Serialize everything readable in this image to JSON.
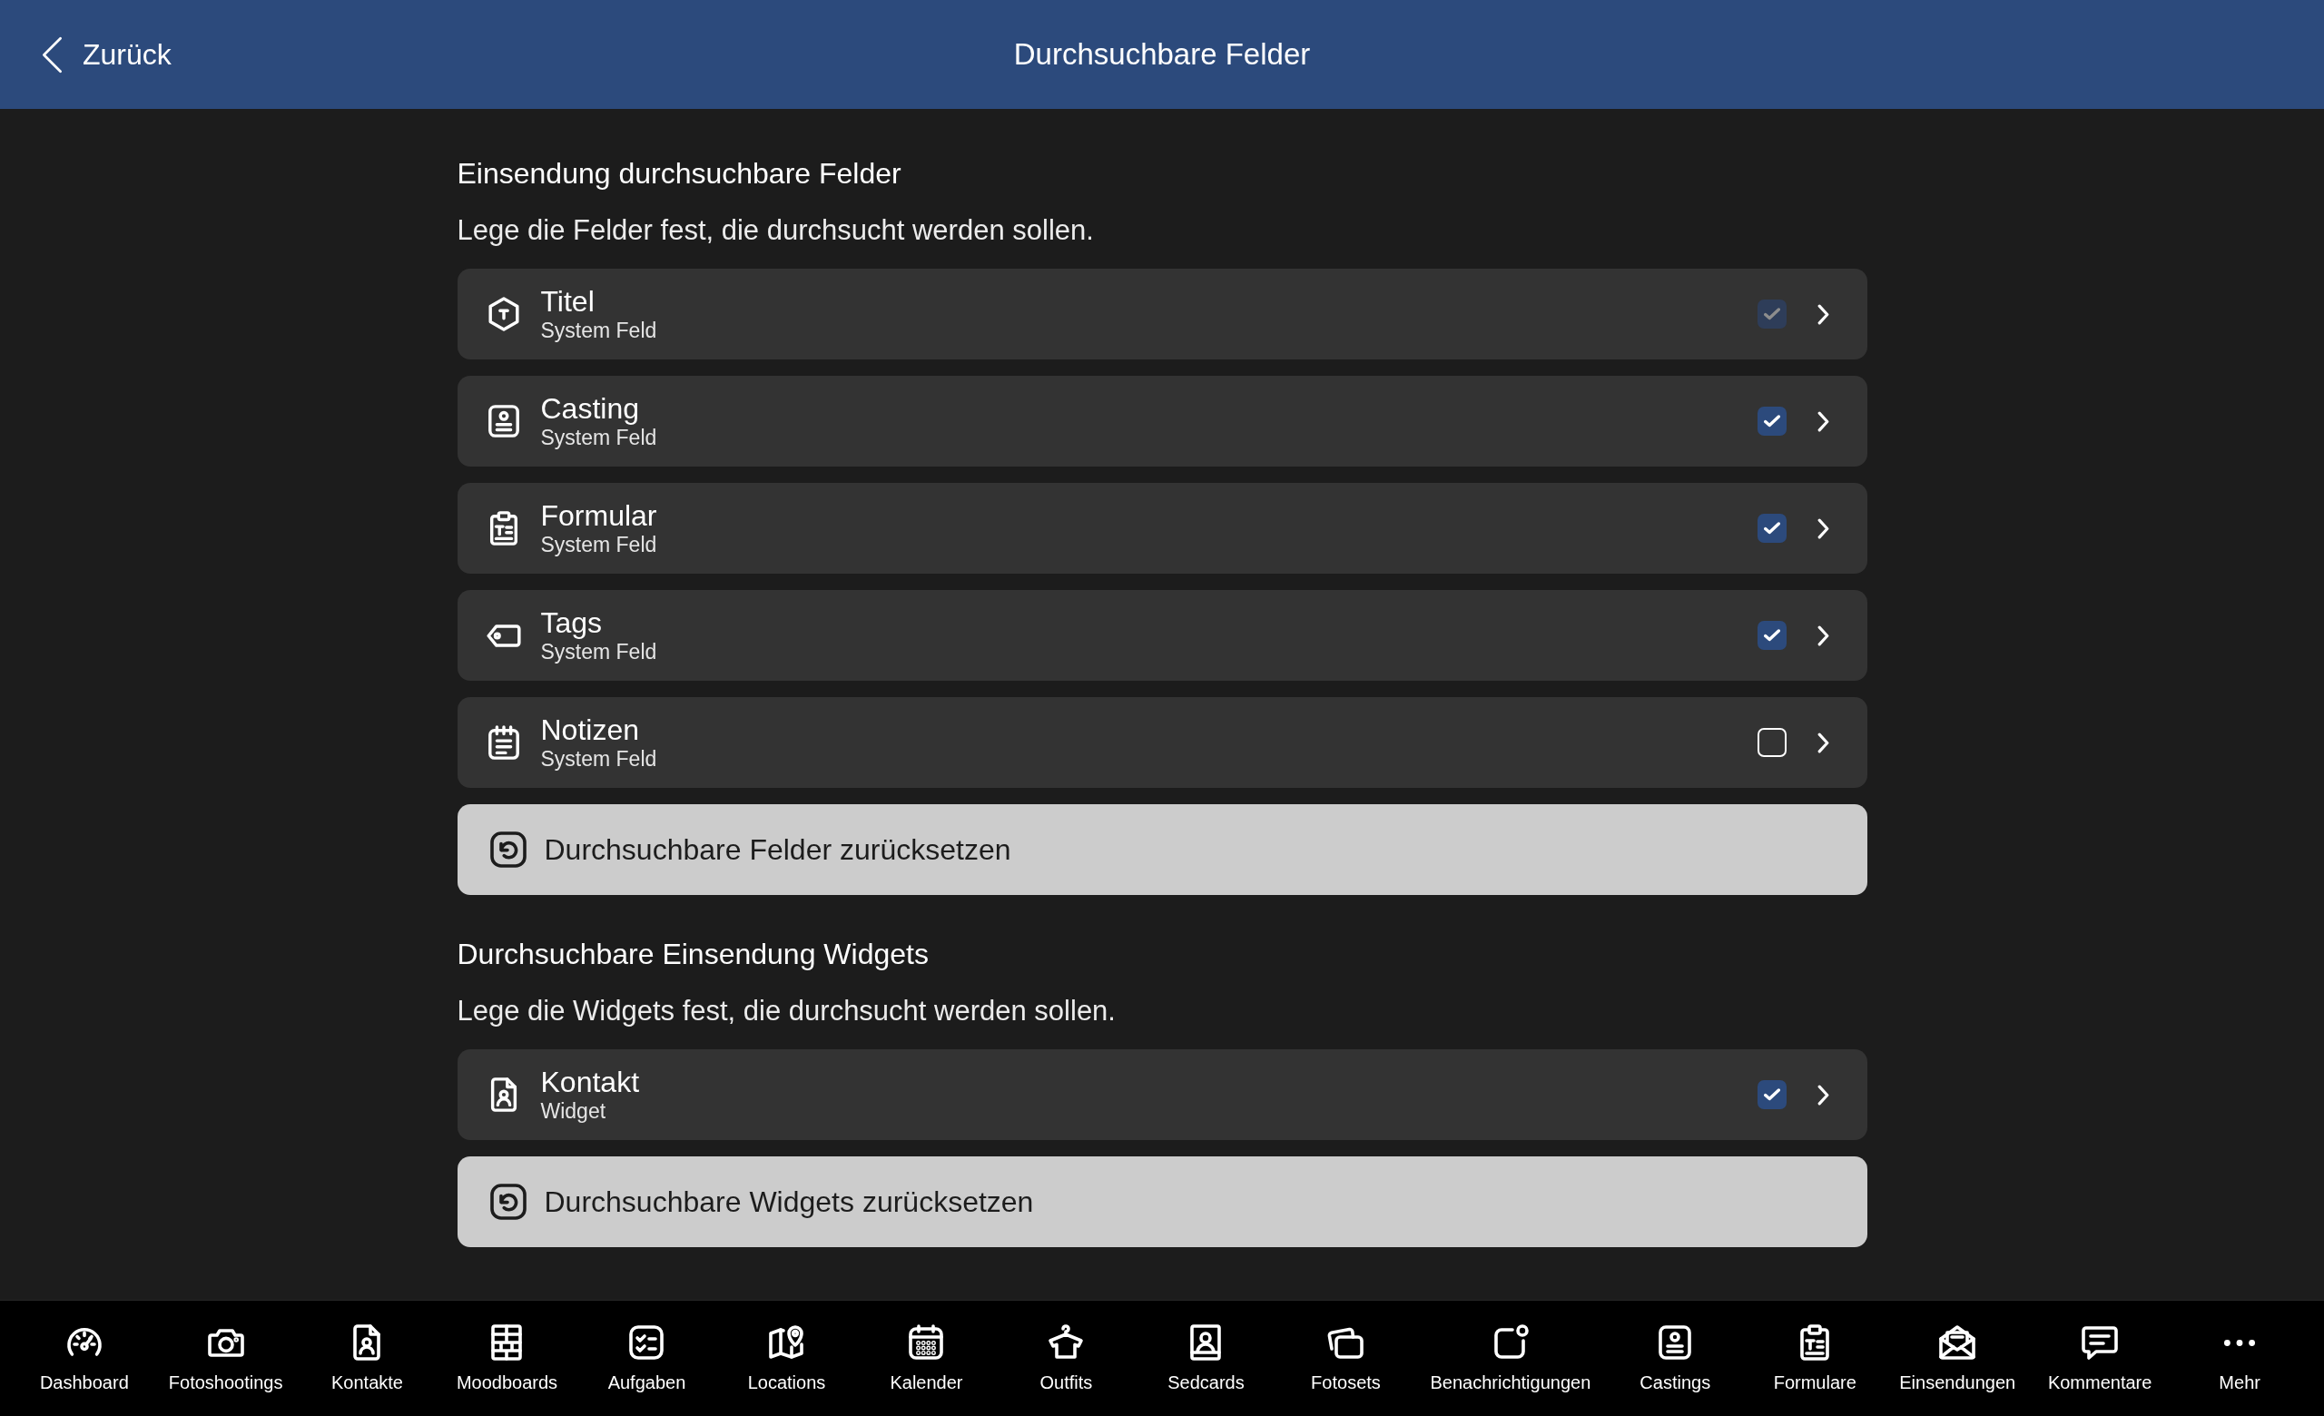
{
  "header": {
    "back_label": "Zurück",
    "title": "Durchsuchbare Felder"
  },
  "sections": [
    {
      "heading": "Einsendung durchsuchbare Felder",
      "description": "Lege die Felder fest, die durchsucht werden sollen.",
      "items": [
        {
          "title": "Titel",
          "subtitle": "System Feld",
          "checked": true,
          "disabled": true
        },
        {
          "title": "Casting",
          "subtitle": "System Feld",
          "checked": true,
          "disabled": false
        },
        {
          "title": "Formular",
          "subtitle": "System Feld",
          "checked": true,
          "disabled": false
        },
        {
          "title": "Tags",
          "subtitle": "System Feld",
          "checked": true,
          "disabled": false
        },
        {
          "title": "Notizen",
          "subtitle": "System Feld",
          "checked": false,
          "disabled": false
        }
      ],
      "reset_button": "Durchsuchbare Felder zurücksetzen"
    },
    {
      "heading": "Durchsuchbare Einsendung Widgets",
      "description": "Lege die Widgets fest, die durchsucht werden sollen.",
      "items": [
        {
          "title": "Kontakt",
          "subtitle": "Widget",
          "checked": true,
          "disabled": false
        }
      ],
      "reset_button": "Durchsuchbare Widgets zurücksetzen"
    }
  ],
  "tab_bar": {
    "items": [
      {
        "label": "Dashboard"
      },
      {
        "label": "Fotoshootings"
      },
      {
        "label": "Kontakte"
      },
      {
        "label": "Moodboards"
      },
      {
        "label": "Aufgaben"
      },
      {
        "label": "Locations"
      },
      {
        "label": "Kalender"
      },
      {
        "label": "Outfits"
      },
      {
        "label": "Sedcards"
      },
      {
        "label": "Fotosets"
      },
      {
        "label": "Benachrichtigungen"
      },
      {
        "label": "Castings"
      },
      {
        "label": "Formulare"
      },
      {
        "label": "Einsendungen"
      },
      {
        "label": "Kommentare"
      },
      {
        "label": "Mehr"
      }
    ]
  }
}
